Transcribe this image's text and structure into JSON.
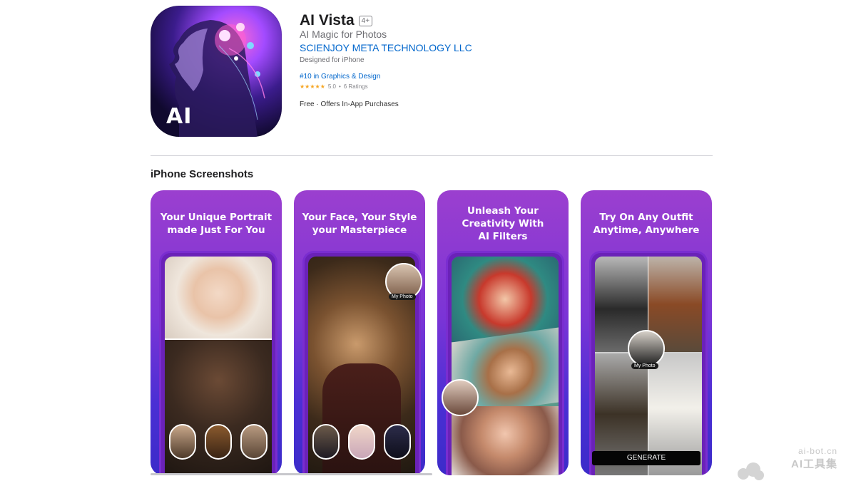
{
  "app": {
    "title": "AI Vista",
    "age_rating": "4+",
    "subtitle": "AI Magic for Photos",
    "developer": "SCIENJOY META TECHNOLOGY LLC",
    "designed_for": "Designed for iPhone",
    "rank": "#10 in Graphics & Design",
    "rating": {
      "stars": "★★★★★",
      "value": "5.0",
      "separator": "•",
      "count": "6 Ratings"
    },
    "price": "Free · Offers In-App Purchases",
    "icon_text": "AI"
  },
  "screenshots_section": {
    "title": "iPhone Screenshots",
    "shots": [
      {
        "caption_line1": "Your Unique Portrait",
        "caption_line2": "made Just For You"
      },
      {
        "caption_line1": "Your Face, Your Style",
        "caption_line2": "your Masterpiece",
        "tag": "My Photo"
      },
      {
        "caption_line1": "Unleash Your",
        "caption_line2": "Creativity With",
        "caption_line3": "AI Filters"
      },
      {
        "caption_line1": "Try On Any Outfit",
        "caption_line2": "Anytime, Anywhere",
        "tag": "My Photo",
        "button": "GENERATE"
      }
    ]
  },
  "watermark": {
    "line1": "ai-bot.cn",
    "line2": "AI工具集"
  },
  "colors": {
    "accent_link": "#0066cc",
    "star": "#f6a623",
    "card_gradient_top": "#9b3fcf",
    "card_gradient_bottom": "#3b2bc9"
  }
}
